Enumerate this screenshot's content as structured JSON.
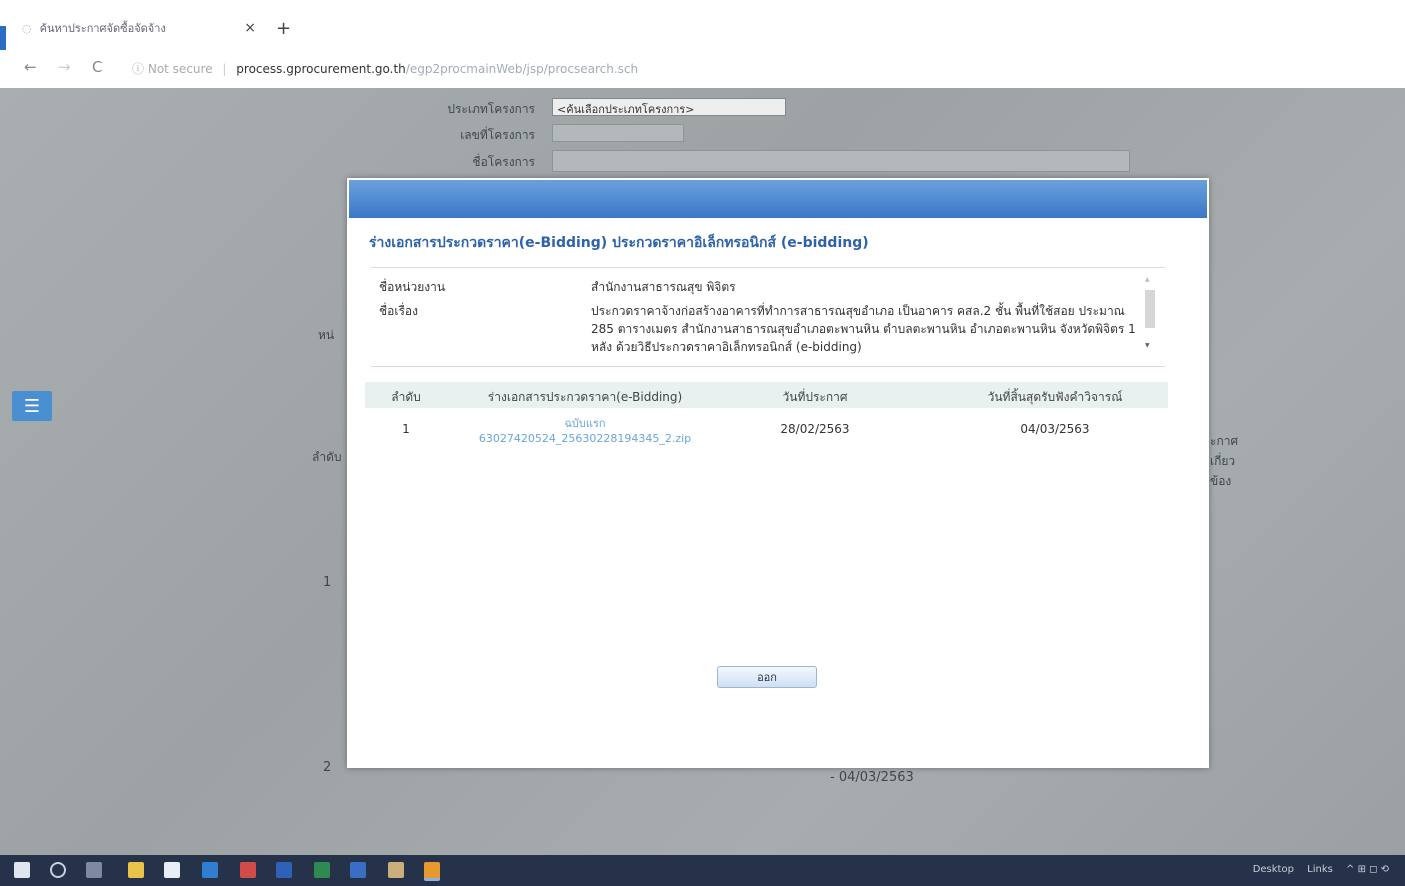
{
  "browser": {
    "tab_title": "ค้นหาประกาศจัดซื้อจัดจ้าง",
    "tab_close": "×",
    "new_tab": "+",
    "back": "←",
    "forward": "→",
    "reload": "C",
    "security_icon": "ⓘ",
    "security_label": "Not secure",
    "separator": "|",
    "url_host": "process.gprocurement.go.th",
    "url_path": "/egp2procmainWeb/jsp/procsearch.sch"
  },
  "background_form": {
    "project_type_label": "ประเภทโครงการ",
    "project_type_value": "<ค้นเลือกประเภทโครงการ>",
    "project_number_label": "เลขที่โครงการ",
    "project_name_label": "ชื่อโครงการ",
    "left_label_partial": "หน่",
    "order_label_partial": "ลำดับ",
    "row1_number": "1",
    "row2_number": "2",
    "row2_date": "- 04/03/2563",
    "side_partial_1": "ะกาศ",
    "side_partial_2": "เกี่ยว",
    "side_partial_3": "ข้อง"
  },
  "menu_icon": "☰",
  "modal": {
    "title": "ร่างเอกสารประกวดราคา(e-Bidding) ประกวดราคาอิเล็กทรอนิกส์ (e-bidding)",
    "agency_label": "ชื่อหน่วยงาน",
    "agency_value": "สำนักงานสาธารณสุข พิจิตร",
    "subject_label": "ชื่อเรื่อง",
    "subject_value": "ประกวดราคาจ้างก่อสร้างอาคารที่ทำการสาธารณสุขอำเภอ เป็นอาคาร คสล.2 ชั้น พื้นที่ใช้สอย ประมาณ 285 ตารางเมตร สำนักงานสาธารณสุขอำเภอตะพานหิน ตำบลตะพานหิน อำเภอตะพานหิน จังหวัดพิจิตร 1 หลัง ด้วยวิธีประกวดราคาอิเล็กทรอนิกส์ (e-bidding)",
    "scroll_up": "▲",
    "scroll_down": "▼",
    "table": {
      "headers": [
        "ลำดับ",
        "ร่างเอกสารประกวดราคา(e-Bidding)",
        "วันที่ประกาศ",
        "วันที่สิ้นสุดรับฟังคำวิจารณ์"
      ],
      "rows": [
        {
          "no": "1",
          "doc_edition": "ฉบับแรก",
          "doc_file": "63027420524_25630228194345_2.zip",
          "announce_date": "28/02/2563",
          "end_date": "04/03/2563"
        }
      ]
    },
    "close_label": "ออก"
  },
  "taskbar": {
    "desktop_label": "Desktop",
    "links_label": "Links",
    "tray_icons": "^ ⊞ ◻ ⟲"
  }
}
